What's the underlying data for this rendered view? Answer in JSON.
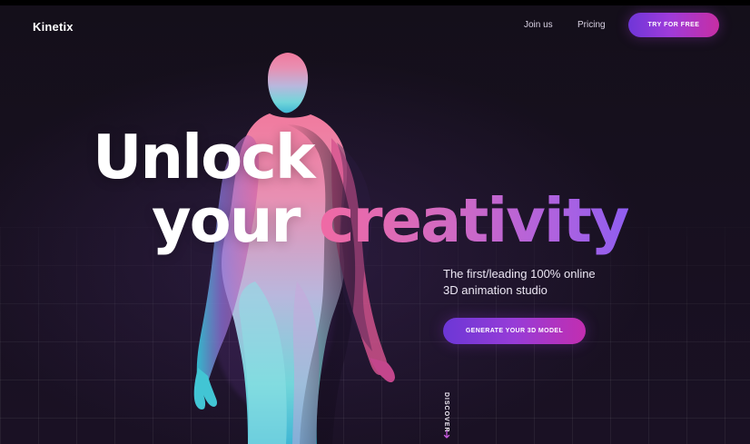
{
  "header": {
    "logo": "Kinetix",
    "nav": [
      {
        "label": "Join us"
      },
      {
        "label": "Pricing"
      }
    ],
    "cta_label": "TRY FOR FREE"
  },
  "hero": {
    "title_line_1": "Unlock",
    "title_line_2_word_1": "your ",
    "title_line_2_word_2": "creativity",
    "subtitle": "The first/leading 100% online\n3D animation studio",
    "cta_label": "GENERATE YOUR 3D MODEL",
    "discover_label": "DISCOVER"
  },
  "icons": {
    "discover": "arrow-icon"
  },
  "colors": {
    "background": "#150f1b",
    "accent_start": "#6f36d8",
    "accent_mid": "#9e3bda",
    "accent_end": "#c72ea4",
    "title_gradient_start": "#f06aa4",
    "title_gradient_end": "#8f5ef0"
  }
}
